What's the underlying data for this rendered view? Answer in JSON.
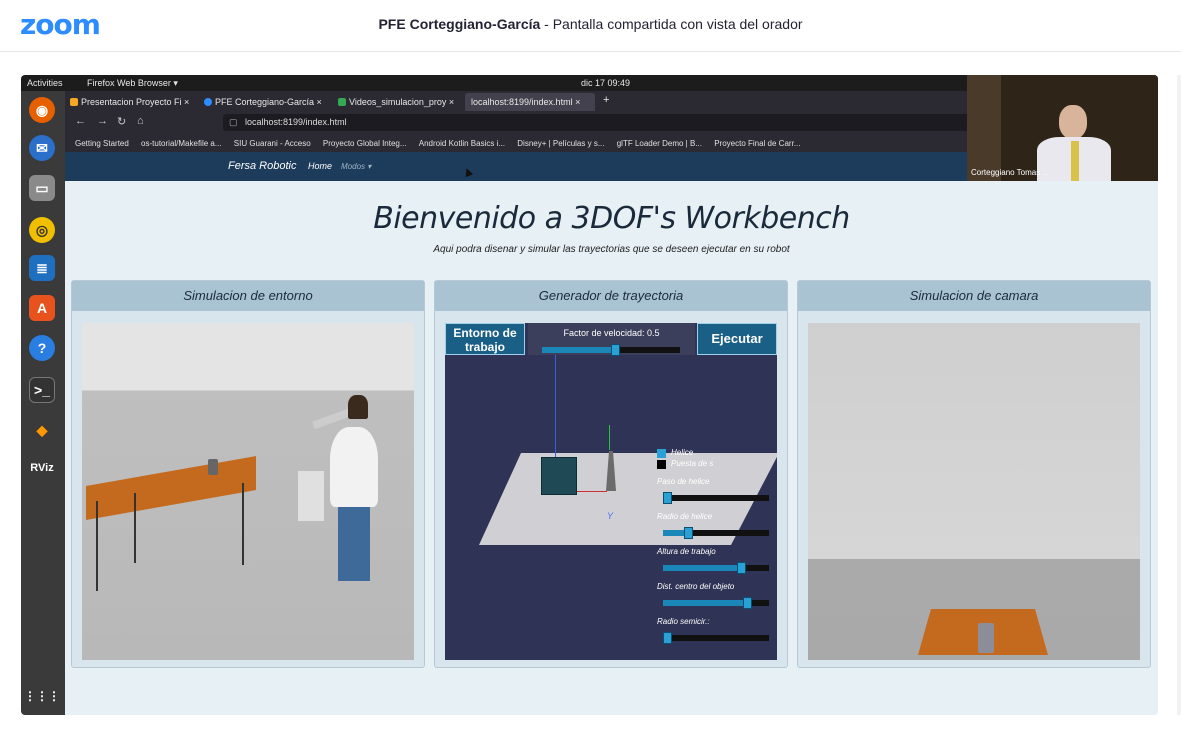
{
  "zoom": {
    "logo": "zoom",
    "meeting_title": "PFE Corteggiano-García",
    "meeting_subtitle": "- Pantalla compartida con vista del orador"
  },
  "desktop": {
    "activities": "Activities",
    "app_menu": "Firefox Web Browser ▾",
    "clock": "dic 17  09:49",
    "dock_icons": [
      "firefox-icon",
      "thunderbird-icon",
      "files-icon",
      "rhythmbox-icon",
      "libreoffice-writer-icon",
      "software-center-icon",
      "help-icon",
      "terminal-icon",
      "sublime-icon",
      "rviz-icon",
      "app-grid-icon"
    ],
    "rviz_label": "RViz",
    "grid_label": "⋮⋮⋮"
  },
  "browser": {
    "tabs": [
      {
        "label": "Presentacion Proyecto Fi ×",
        "color": "#f5a623"
      },
      {
        "label": "PFE Corteggiano-García  ×",
        "color": "#2d8cff"
      },
      {
        "label": "Videos_simulacion_proy ×",
        "color": "#34a853"
      },
      {
        "label": "localhost:8199/index.html  ×",
        "color": ""
      }
    ],
    "new_tab": "+",
    "url": "localhost:8199/index.html",
    "bookmarks": [
      "Getting Started",
      "os-tutorial/Makefile a...",
      "SIU Guarani - Acceso",
      "Proyecto Global Integ...",
      "Android Kotlin Basics i...",
      "Disney+ | Películas y s...",
      "glTF Loader Demo | B...",
      "Proyecto Final de Carr..."
    ]
  },
  "site": {
    "brand": "Fersa Robotic",
    "home": "Home",
    "modos": "Modos ▾",
    "title": "Bienvenido a 3DOF's Workbench",
    "subtitle": "Aqui podra disenar y simular las trayectorias que se deseen ejecutar en su robot",
    "panels": {
      "env": "Simulacion de entorno",
      "gen": "Generador de trayectoria",
      "cam": "Simulacion de camara"
    },
    "generator": {
      "workspace_button": "Entorno de trabajo",
      "speed_label": "Factor de velocidad: 0.5",
      "speed_value": 0.5,
      "execute_button": "Ejecutar",
      "helix_label": "Helice",
      "setup_label": "Puesta de s",
      "controls": [
        {
          "label": "Paso de helice",
          "value": 0.0
        },
        {
          "label": "Radio de helice",
          "value": 0.2
        },
        {
          "label": "Altura de trabajo",
          "value": 0.7
        },
        {
          "label": "Dist. centro del objeto",
          "value": 0.75
        },
        {
          "label": "Radio semicir.:",
          "value": 0.0
        }
      ],
      "axis_label": "Y"
    }
  },
  "speaker": {
    "name": "Corteggiano Tomas ..."
  },
  "colors": {
    "zoom_blue": "#2d8cff",
    "panel_head": "#a9c3d3",
    "nav_bg": "#1d3b5a",
    "button_blue": "#1a5f86"
  }
}
